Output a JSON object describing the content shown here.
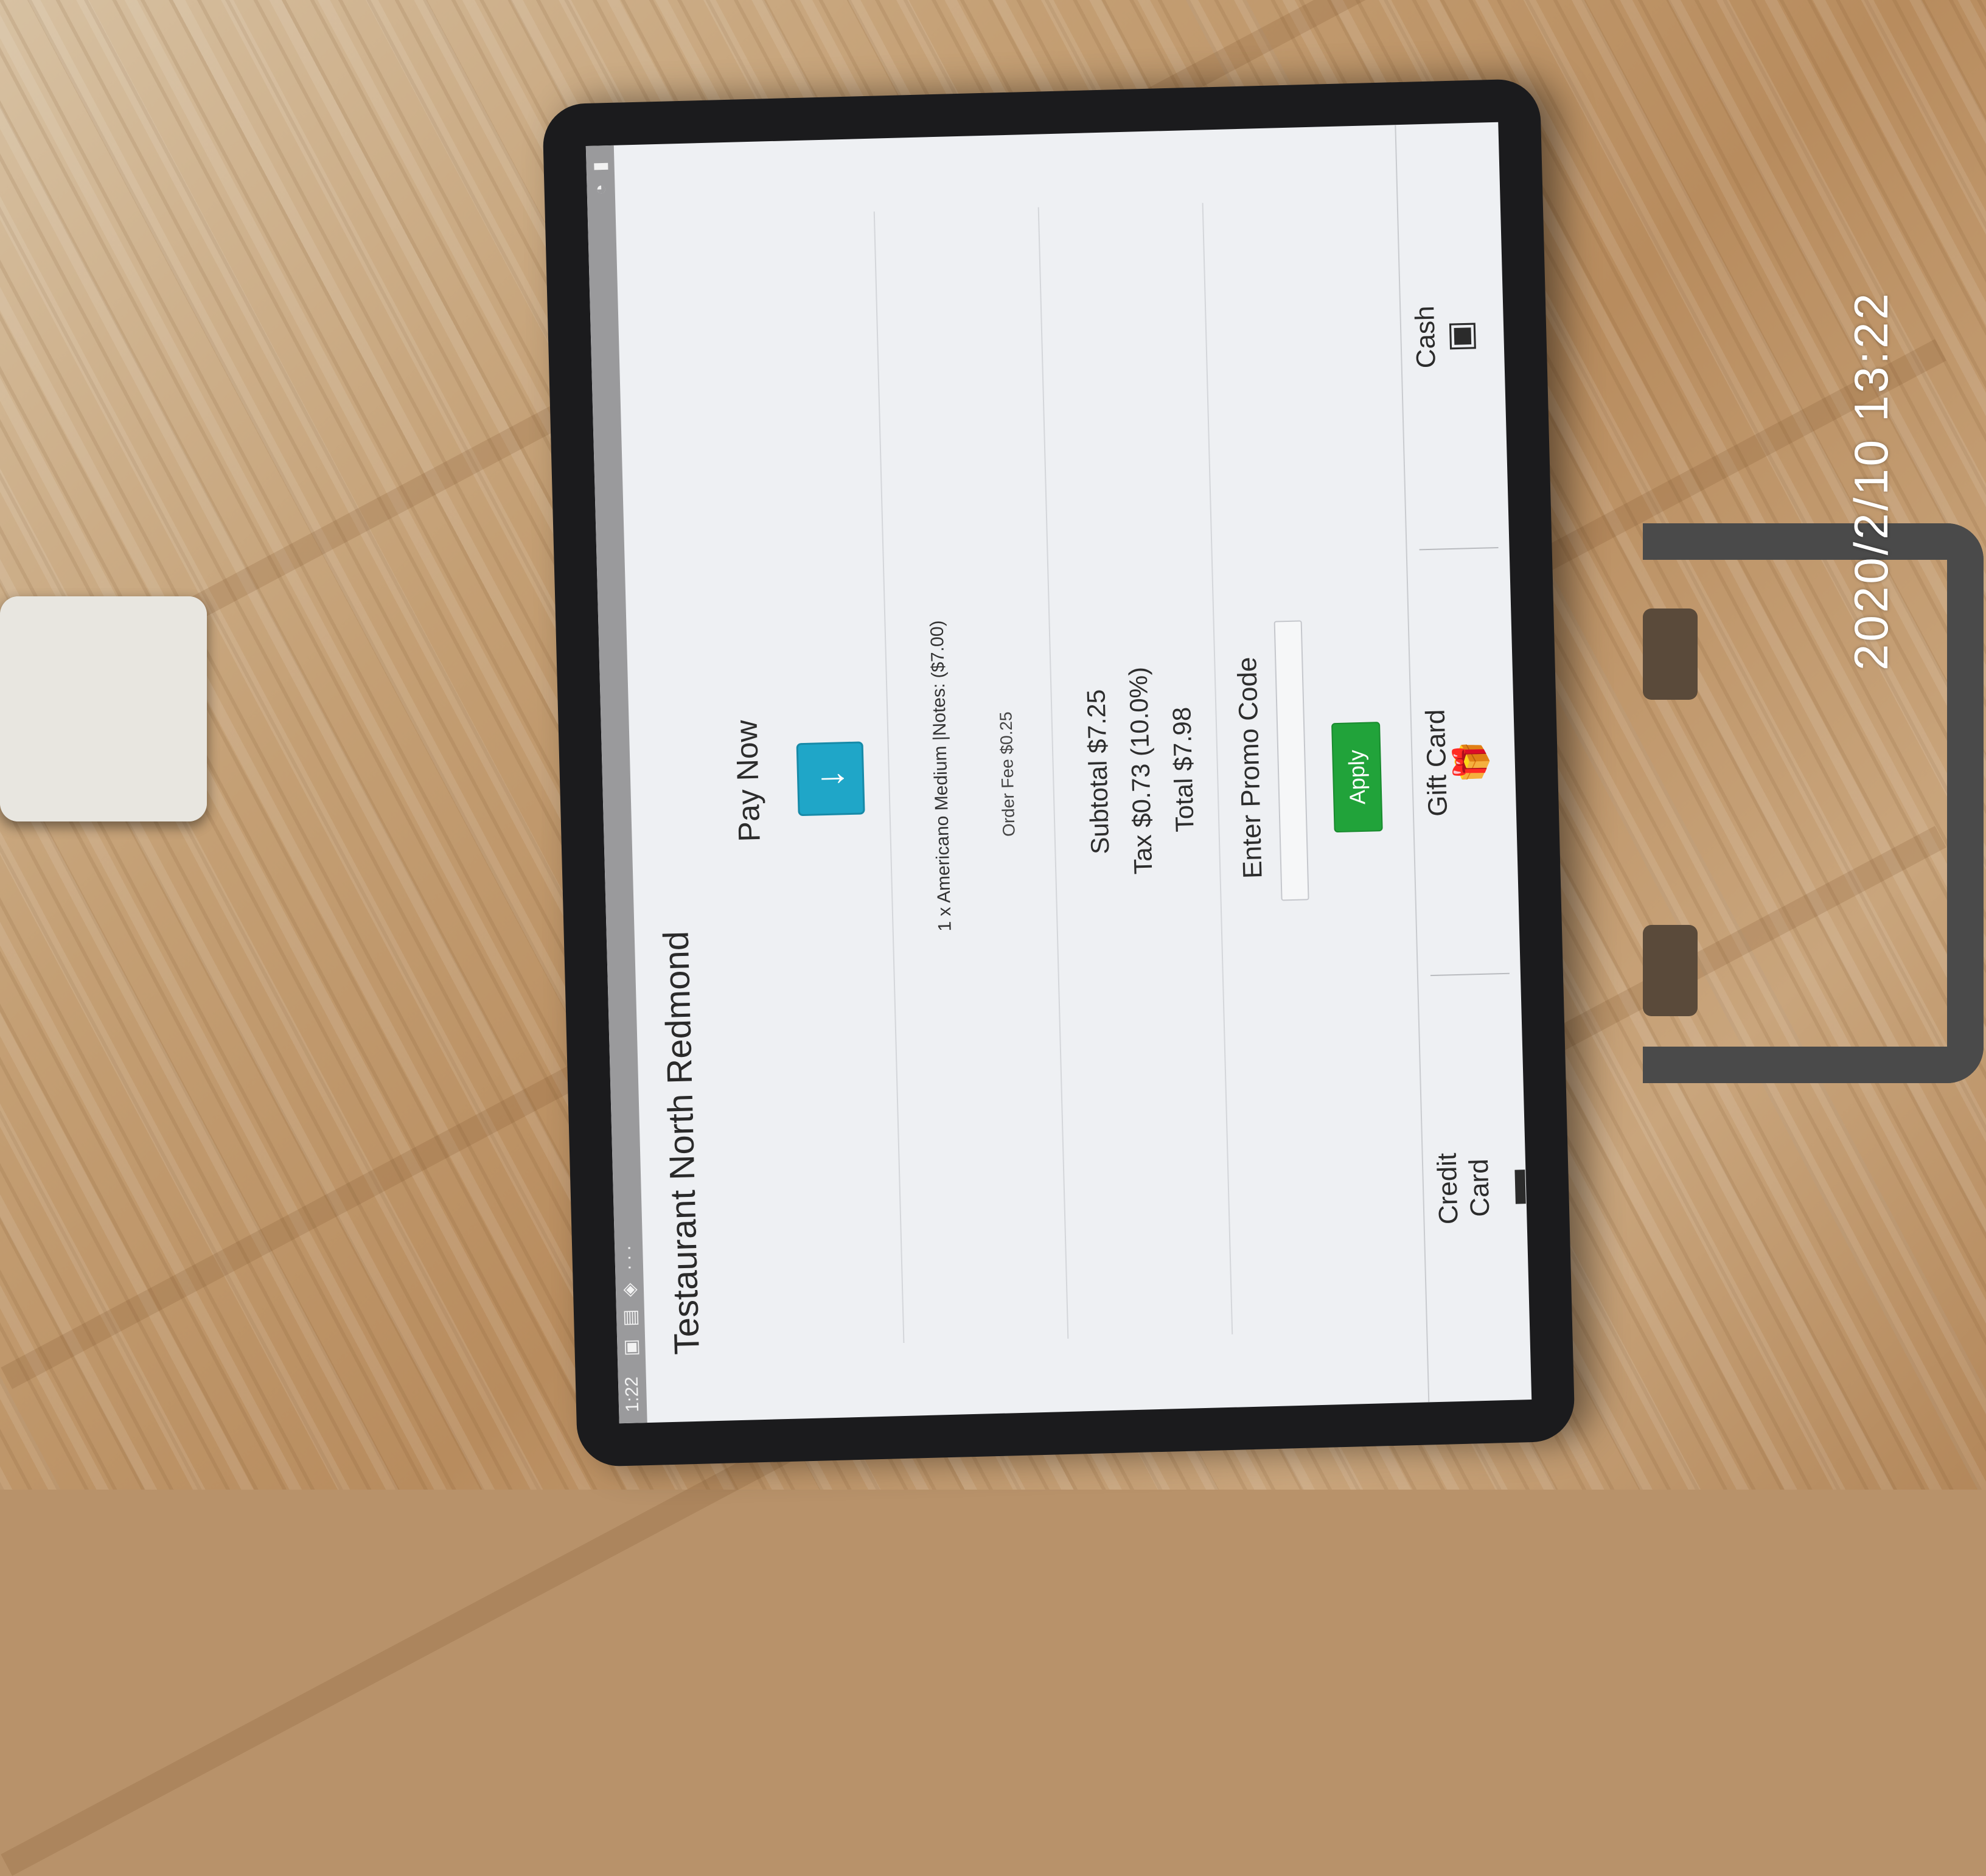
{
  "photo": {
    "timestamp": "2020/2/10  13:22"
  },
  "statusbar": {
    "time": "1:22",
    "left_icons": "▣ ▤ ◈ ···",
    "right_icons": "◔ ▮"
  },
  "app": {
    "title": "Testaurant North Redmond",
    "pay_now": "Pay Now",
    "order_line": "1 x Americano Medium |Notes: ($7.00)",
    "order_fee": "Order Fee $0.25",
    "subtotal": "Subtotal $7.25",
    "tax": "Tax $0.73 (10.0%)",
    "total": "Total $7.98",
    "promo_label": "Enter Promo Code",
    "promo_value": "",
    "apply_label": "Apply"
  },
  "payment_methods": [
    {
      "label": "Credit\nCard",
      "icon": "credit-card-icon",
      "glyph": "▬"
    },
    {
      "label": "Gift Card",
      "icon": "gift-icon",
      "glyph": "🎁"
    },
    {
      "label": "Cash",
      "icon": "cash-icon",
      "glyph": "▣"
    }
  ],
  "colors": {
    "pay_button": "#1fa6c8",
    "apply_button": "#21a33a",
    "screen_bg": "#eef0f3"
  }
}
